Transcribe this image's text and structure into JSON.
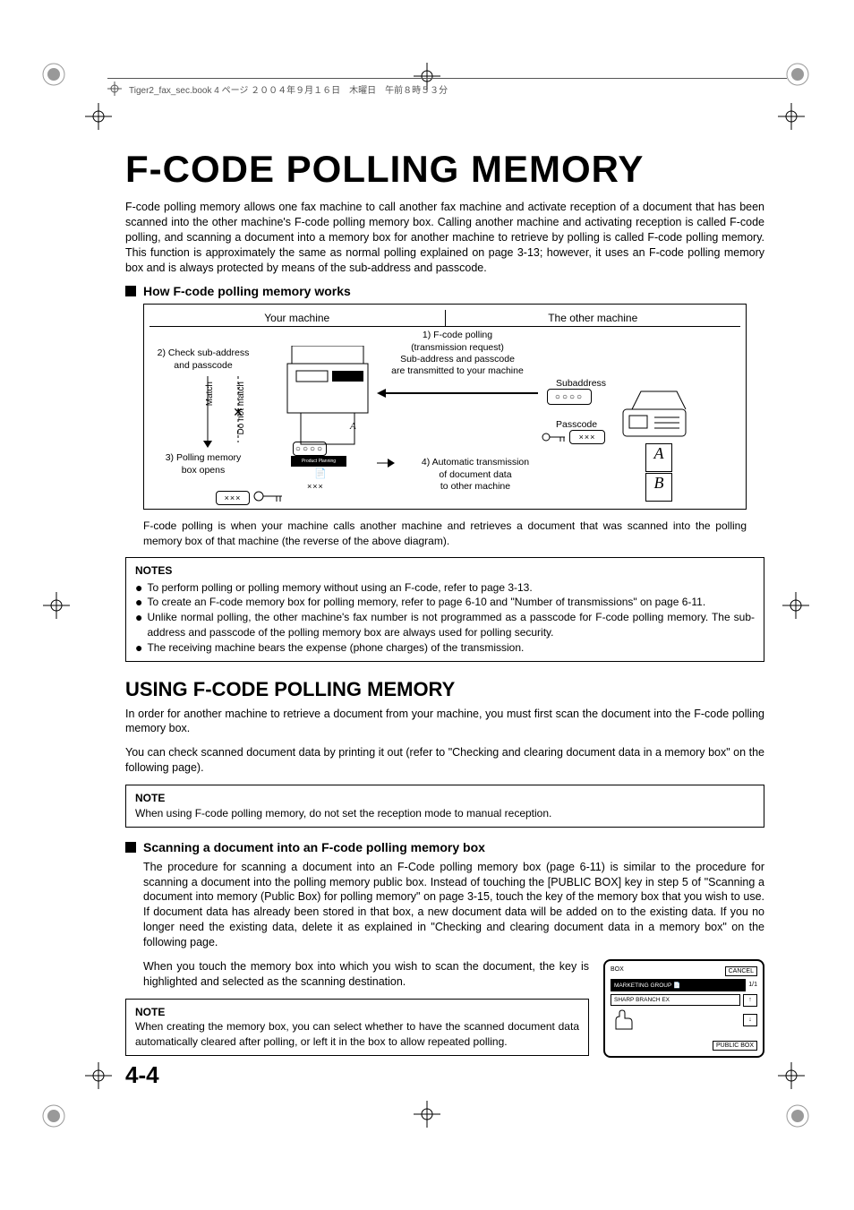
{
  "header": {
    "crop_info": "Tiger2_fax_sec.book  4 ページ  ２００４年９月１６日　木曜日　午前８時５３分"
  },
  "title": "F-CODE POLLING MEMORY",
  "intro": "F-code polling memory allows one fax machine to call another fax machine and activate reception of a document that has been scanned into the other machine's F-code polling memory box. Calling another machine and activating reception is called F-code polling, and scanning a document into a memory box for another machine to retrieve by polling is called F-code polling memory. This function is approximately the same as normal polling explained on page 3-13; however, it uses an F-code polling memory box and is always protected by means of the sub-address and passcode.",
  "section1_heading": "How F-code polling memory works",
  "diagram": {
    "left_header": "Your machine",
    "right_header": "The other machine",
    "step1": "1) F-code polling\n(transmission request)\nSub-address and passcode\nare transmitted to your machine",
    "step2": "2) Check sub-address\nand passcode",
    "match": "Match",
    "nomatch": "Do not match",
    "step3": "3) Polling memory\nbox opens",
    "step4": "4) Automatic transmission\nof document data\nto other machine",
    "subaddress": "Subaddress",
    "passcode": "Passcode",
    "doc_a": "A",
    "doc_b": "B",
    "product_label": "Product Planning"
  },
  "diagram_caption": "F-code polling is when your machine calls another machine and retrieves a document that was scanned into the polling memory box of that machine (the reverse of the above diagram).",
  "notes1": {
    "title": "NOTES",
    "items": [
      "To perform polling or polling memory without using an F-code, refer to page 3-13.",
      "To create an F-code memory box for polling memory, refer to page 6-10 and \"Number of transmissions\" on page 6-11.",
      "Unlike normal polling, the other machine's fax number is not programmed as a passcode for F-code polling memory. The sub-address and passcode of the polling memory box are always used for polling security.",
      "The receiving machine bears the expense (phone charges) of the transmission."
    ]
  },
  "section2_heading": "USING F-CODE POLLING MEMORY",
  "section2_p1": "In order for another machine to retrieve a document from your machine, you must first scan the document into the F-code polling memory box.",
  "section2_p2": "You can check scanned document data by printing it out (refer to \"Checking and clearing document data in a memory box\" on the following page).",
  "note2": {
    "title": "NOTE",
    "text": "When using F-code polling memory, do not set the reception mode to manual reception."
  },
  "section3_heading": "Scanning a document into an F-code polling memory box",
  "section3_p1": "The procedure for scanning a document into an F-Code polling memory box (page 6-11) is similar to the procedure for scanning a document into the polling memory public box. Instead of touching the [PUBLIC BOX] key in step 5 of \"Scanning a document into memory (Public Box) for polling memory\" on page 3-15, touch the key of the memory box that you wish to use. If document data has already been stored in that box, a new document data will be added on to the existing data. If you no longer need the existing data, delete it as explained in \"Checking and clearing document data in a memory box\" on the following page.",
  "section3_p2": "When you touch the memory box into which you wish to scan the document, the key is highlighted and selected as the scanning destination.",
  "note3": {
    "title": "NOTE",
    "text": "When creating the memory box, you can select whether to have the scanned document data automatically cleared after polling, or left it in the box to allow repeated polling."
  },
  "lcd": {
    "box_label": "BOX",
    "cancel": "CANCEL",
    "key1": "MARKETING GROUP",
    "key2": "SHARP BRANCH EX",
    "page": "1/1",
    "up": "↑",
    "down": "↓",
    "public": "PUBLIC BOX"
  },
  "page_number": "4-4"
}
